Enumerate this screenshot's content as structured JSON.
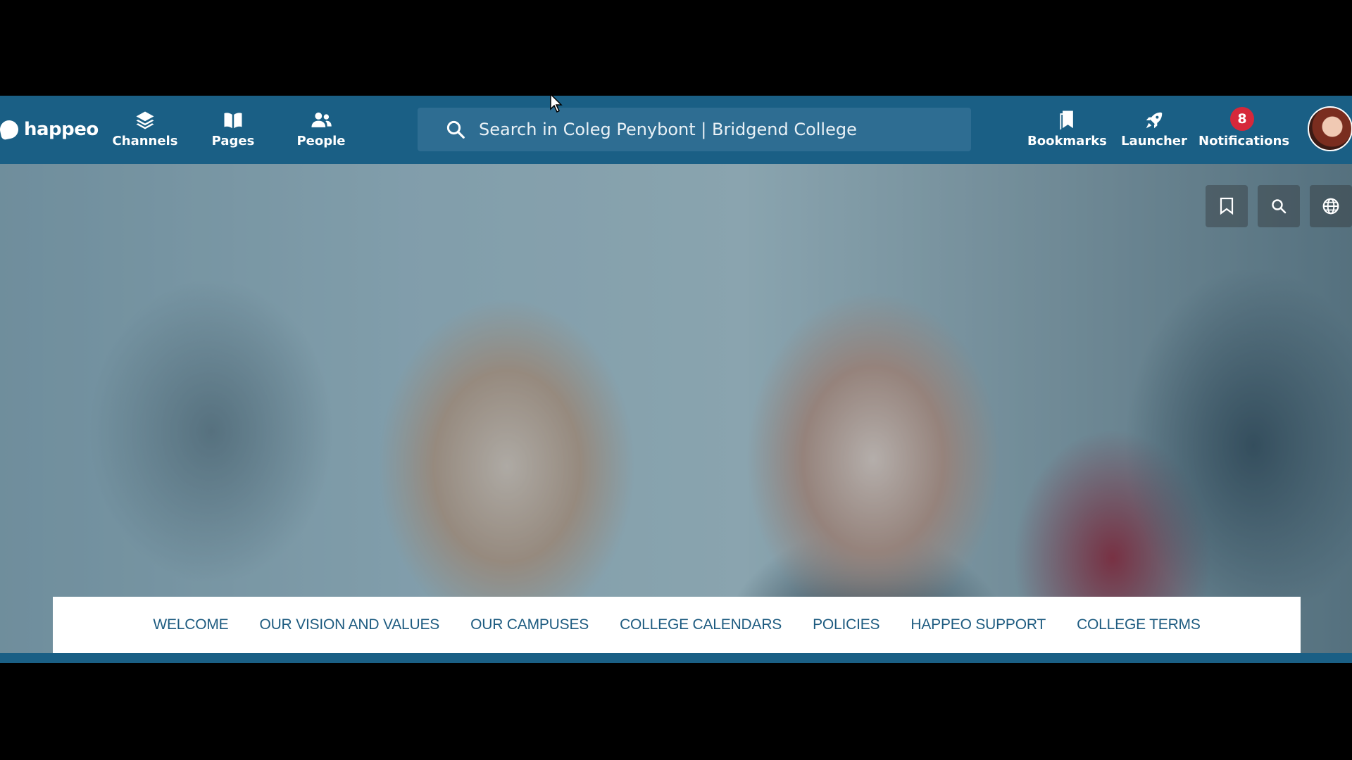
{
  "app": {
    "logo_text": "happeo"
  },
  "nav": {
    "channels_label": "Channels",
    "pages_label": "Pages",
    "people_label": "People",
    "bookmarks_label": "Bookmarks",
    "launcher_label": "Launcher",
    "notifications_label": "Notifications",
    "notifications_count": "8"
  },
  "search": {
    "placeholder": "Search in Coleg Penybont | Bridgend College"
  },
  "hero_tools": {
    "icons": [
      "bookmark-icon",
      "search-icon",
      "globe-icon"
    ]
  },
  "submenu": {
    "items": [
      {
        "label": "WELCOME"
      },
      {
        "label": "OUR VISION AND VALUES"
      },
      {
        "label": "OUR CAMPUSES"
      },
      {
        "label": "COLLEGE CALENDARS"
      },
      {
        "label": "POLICIES"
      },
      {
        "label": "HAPPEO SUPPORT"
      },
      {
        "label": "COLLEGE TERMS"
      }
    ]
  },
  "colors": {
    "brand": "#1a5f85",
    "search_bg": "#2e6d92",
    "badge": "#d6283a",
    "submenu_text": "#1d5b80"
  }
}
